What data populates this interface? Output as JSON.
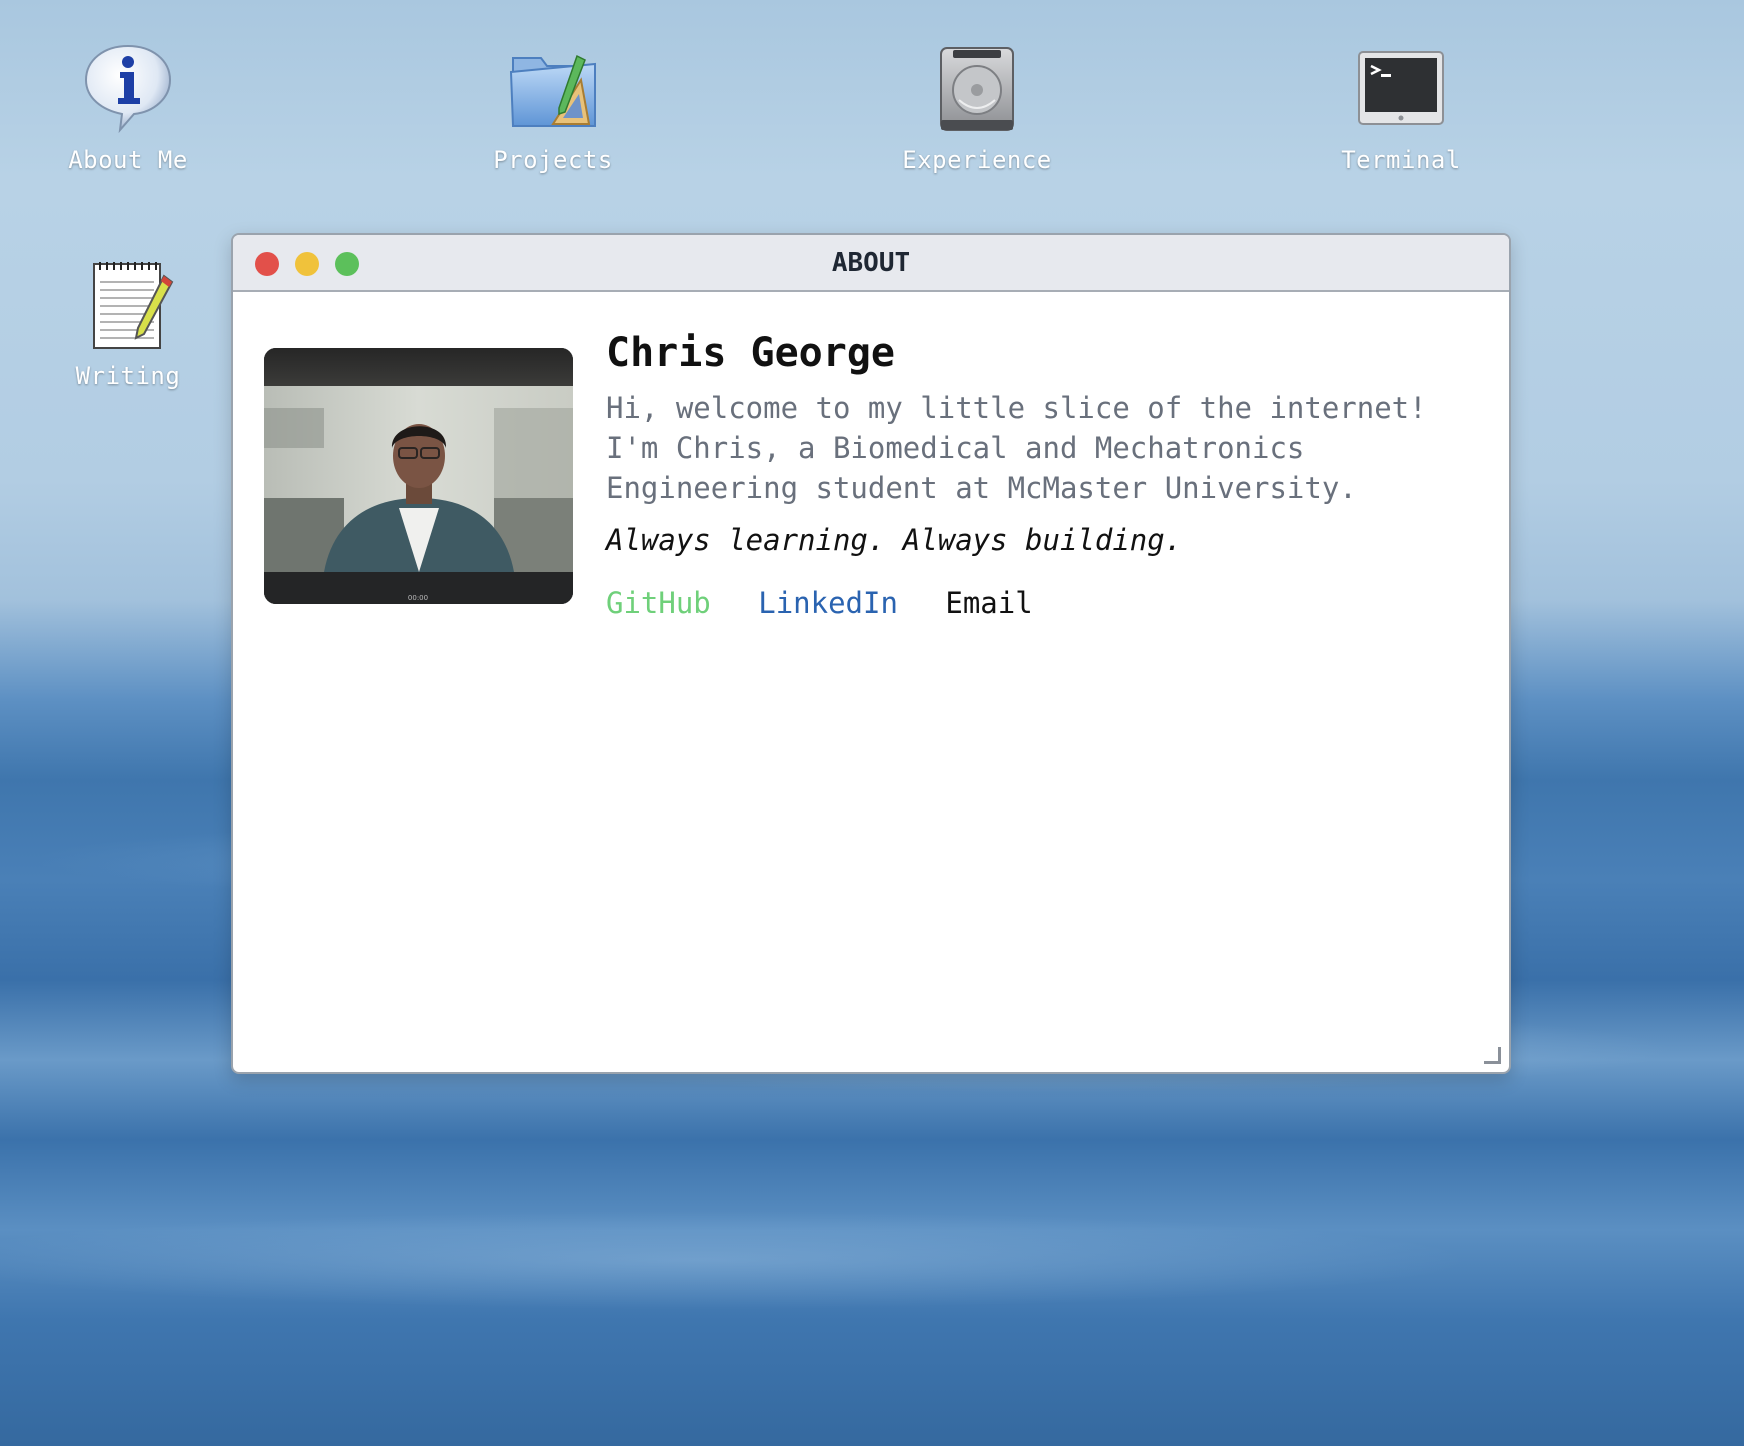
{
  "desktop": {
    "icons": [
      {
        "label": "About Me",
        "icon": "info-bubble-icon"
      },
      {
        "label": "Projects",
        "icon": "projects-folder-icon"
      },
      {
        "label": "Experience",
        "icon": "hard-drive-icon"
      },
      {
        "label": "Terminal",
        "icon": "terminal-icon"
      },
      {
        "label": "Writing",
        "icon": "notepad-pencil-icon"
      }
    ]
  },
  "window": {
    "title": "ABOUT",
    "controls": [
      "close",
      "minimize",
      "maximize"
    ],
    "name": "Chris George",
    "bio": "Hi, welcome to my little slice of the internet! I'm Chris, a Biomedical and Mechatronics Engineering student at McMaster University.",
    "motto": "Always learning. Always building.",
    "links": [
      {
        "label": "GitHub",
        "color": "#6fd07a"
      },
      {
        "label": "LinkedIn",
        "color": "#2a63b0"
      },
      {
        "label": "Email",
        "color": "#111111"
      }
    ],
    "photo": {
      "timestamp": "00:00",
      "description": "profile-photo"
    }
  },
  "colors": {
    "close": "#e2504a",
    "minimize": "#f0c23b",
    "maximize": "#5cc05b",
    "titlebar": "#e7e9ee"
  }
}
